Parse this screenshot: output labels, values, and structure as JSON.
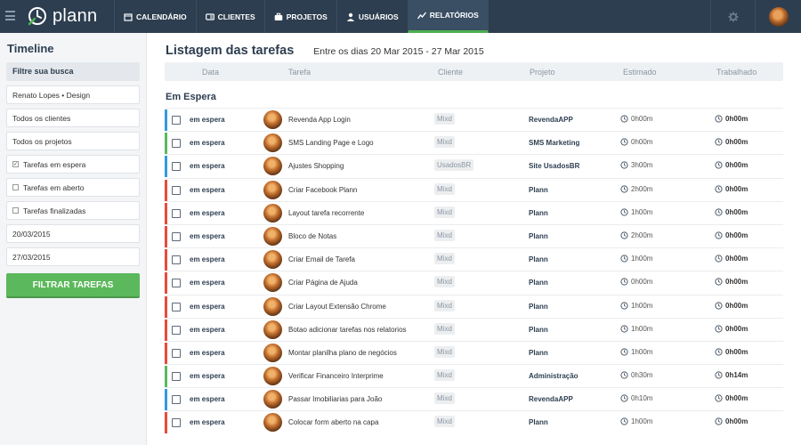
{
  "app": {
    "logo_text": "plann"
  },
  "nav": [
    {
      "label": "Calendário",
      "icon": "calendar-icon"
    },
    {
      "label": "Clientes",
      "icon": "id-card-icon"
    },
    {
      "label": "Projetos",
      "icon": "briefcase-icon"
    },
    {
      "label": "Usuários",
      "icon": "user-icon"
    },
    {
      "label": "Relatórios",
      "icon": "chart-icon",
      "active": true
    }
  ],
  "sidebar": {
    "title": "Timeline",
    "filter_heading": "Filtre sua busca",
    "user_select": "Renato Lopes • Design",
    "client_select": "Todos os clientes",
    "project_select": "Todos os projetos",
    "checkboxes": [
      {
        "label": "Tarefas em espera",
        "checked": true
      },
      {
        "label": "Tarefas em aberto",
        "checked": false
      },
      {
        "label": "Tarefas finalizadas",
        "checked": false
      }
    ],
    "date_from": "20/03/2015",
    "date_to": "27/03/2015",
    "filter_button": "Filtrar tarefas"
  },
  "main": {
    "title": "Listagem das tarefas",
    "date_range": "Entre os dias 20 Mar 2015 - 27 Mar 2015",
    "columns": [
      "Data",
      "Tarefa",
      "Cliente",
      "Projeto",
      "Estimado",
      "Trabalhado"
    ],
    "section": "Em Espera",
    "rows": [
      {
        "status": "em espera",
        "task": "Revenda App Login",
        "client": "Mixd",
        "project": "RevendaAPP",
        "estimated": "0h00m",
        "worked": "0h00m",
        "color": "#2f9be0"
      },
      {
        "status": "em espera",
        "task": "SMS Landing Page e Logo",
        "client": "Mixd",
        "project": "SMS Marketing",
        "estimated": "0h00m",
        "worked": "0h00m",
        "color": "#5cb85c"
      },
      {
        "status": "em espera",
        "task": "Ajustes Shopping",
        "client": "UsadosBR",
        "project": "Site UsadosBR",
        "estimated": "3h00m",
        "worked": "0h00m",
        "color": "#2f9be0"
      },
      {
        "status": "em espera",
        "task": "Criar Facebook Plann",
        "client": "Mixd",
        "project": "Plann",
        "estimated": "2h00m",
        "worked": "0h00m",
        "color": "#e74c3c"
      },
      {
        "status": "em espera",
        "task": "Layout tarefa recorrente",
        "client": "Mixd",
        "project": "Plann",
        "estimated": "1h00m",
        "worked": "0h00m",
        "color": "#e74c3c"
      },
      {
        "status": "em espera",
        "task": "Bloco de Notas",
        "client": "Mixd",
        "project": "Plann",
        "estimated": "2h00m",
        "worked": "0h00m",
        "color": "#e74c3c"
      },
      {
        "status": "em espera",
        "task": "Criar Email de Tarefa",
        "client": "Mixd",
        "project": "Plann",
        "estimated": "1h00m",
        "worked": "0h00m",
        "color": "#e74c3c"
      },
      {
        "status": "em espera",
        "task": "Criar Página de Ajuda",
        "client": "Mixd",
        "project": "Plann",
        "estimated": "0h00m",
        "worked": "0h00m",
        "color": "#e74c3c"
      },
      {
        "status": "em espera",
        "task": "Criar Layout Extensão Chrome",
        "client": "Mixd",
        "project": "Plann",
        "estimated": "1h00m",
        "worked": "0h00m",
        "color": "#e74c3c"
      },
      {
        "status": "em espera",
        "task": "Botao adicionar tarefas nos relatorios",
        "client": "Mixd",
        "project": "Plann",
        "estimated": "1h00m",
        "worked": "0h00m",
        "color": "#e74c3c"
      },
      {
        "status": "em espera",
        "task": "Montar planilha plano de negócios",
        "client": "Mixd",
        "project": "Plann",
        "estimated": "1h00m",
        "worked": "0h00m",
        "color": "#e74c3c"
      },
      {
        "status": "em espera",
        "task": "Verificar Financeiro Interprime",
        "client": "Mixd",
        "project": "Administração",
        "estimated": "0h30m",
        "worked": "0h14m",
        "color": "#5cb85c"
      },
      {
        "status": "em espera",
        "task": "Passar Imobiliarias para João",
        "client": "Mixd",
        "project": "RevendaAPP",
        "estimated": "0h10m",
        "worked": "0h00m",
        "color": "#2f9be0"
      },
      {
        "status": "em espera",
        "task": "Colocar form aberto na capa",
        "client": "Mixd",
        "project": "Plann",
        "estimated": "1h00m",
        "worked": "0h00m",
        "color": "#e74c3c"
      }
    ]
  }
}
